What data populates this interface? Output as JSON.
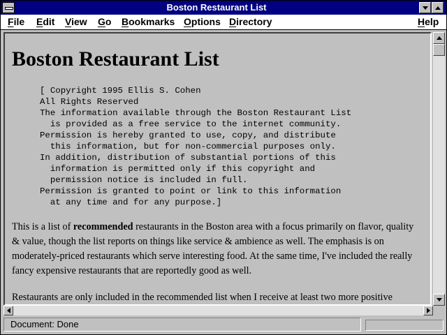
{
  "window": {
    "title": "Boston Restaurant List"
  },
  "menu": {
    "items": [
      "File",
      "Edit",
      "View",
      "Go",
      "Bookmarks",
      "Options",
      "Directory",
      "Help"
    ]
  },
  "content": {
    "heading": "Boston Restaurant List",
    "copyright_lines": [
      "[ Copyright 1995 Ellis S. Cohen",
      "All Rights Reserved",
      "The information available through the Boston Restaurant List",
      "  is provided as a free service to the internet community.",
      "Permission is hereby granted to use, copy, and distribute",
      "  this information, but for non-commercial purposes only.",
      "In addition, distribution of substantial portions of this",
      "  information is permitted only if this copyright and",
      "  permission notice is included in full.",
      "Permission is granted to point or link to this information",
      "  at any time and for any purpose.]"
    ],
    "para1_before": "This is a list of ",
    "para1_bold": "recommended",
    "para1_after": " restaurants in the Boston area with a focus primarily on flavor, quality & value, though the list reports on things like service & ambience as well. The emphasis is on moderately-priced restaurants which serve interesting food. At the same time, I've included the really fancy expensive restaurants that are reportedly good as well.",
    "para2": "Restaurants are only included in the recommended list when I receive at least two more positive"
  },
  "status": {
    "text": "Document: Done",
    "progress": 0
  },
  "colors": {
    "titlebar": "#000080",
    "face": "#c0c0c0",
    "menubar": "#ffffff"
  }
}
